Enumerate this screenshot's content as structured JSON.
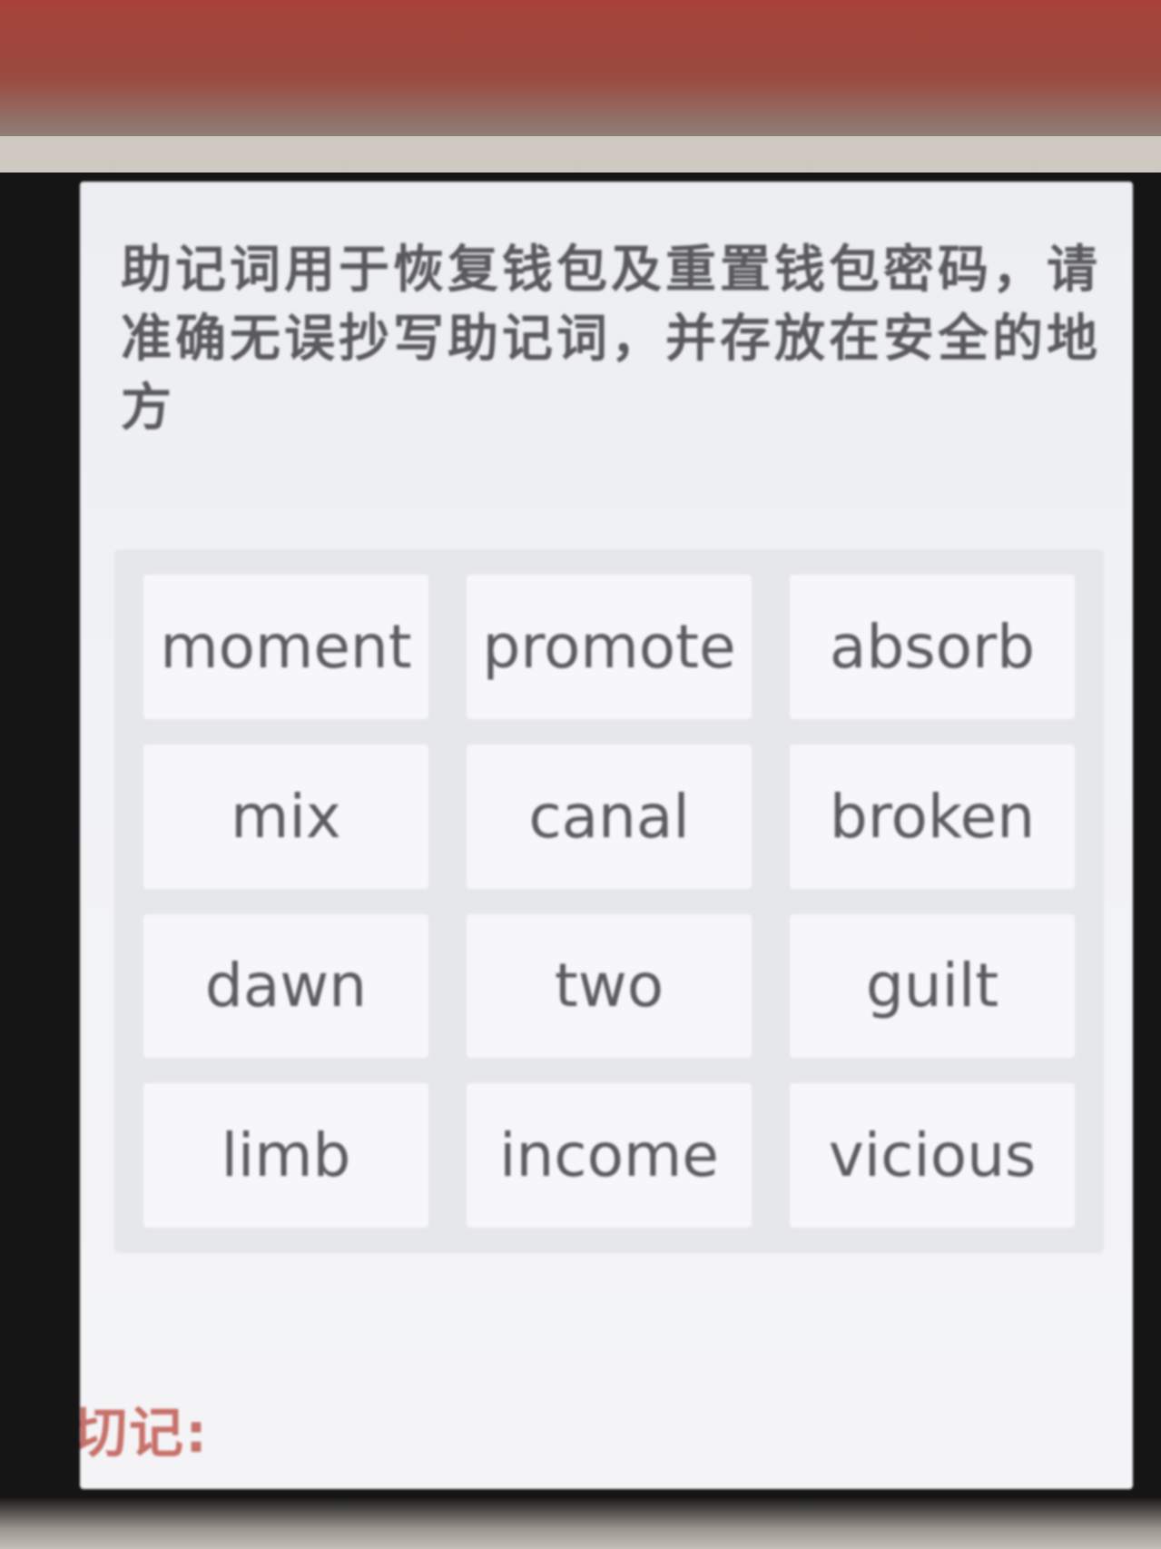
{
  "instruction": "助记词用于恢复钱包及重置钱包密码，请准确无误抄写助记词，并存放在安全的地方",
  "mnemonic_words": [
    "moment",
    "promote",
    "absorb",
    "mix",
    "canal",
    "broken",
    "dawn",
    "two",
    "guilt",
    "limb",
    "income",
    "vicious"
  ],
  "warning_label": "切记:"
}
